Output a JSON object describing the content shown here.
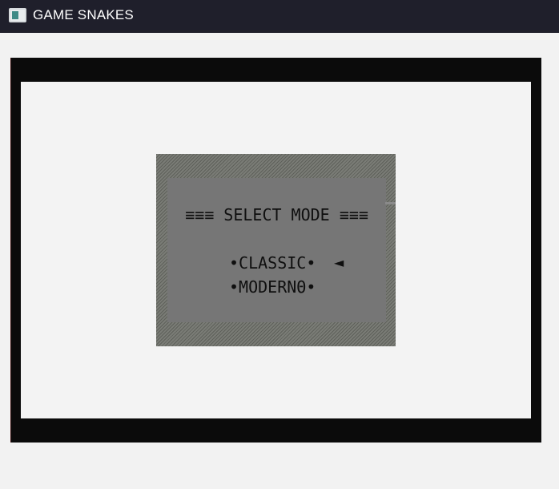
{
  "window": {
    "title": "GAME SNAKES",
    "icon": "app-window-icon"
  },
  "menu": {
    "heading": "≡≡≡ SELECT MODE ≡≡≡",
    "options": [
      {
        "label": "•CLASSIC•",
        "selected": true
      },
      {
        "label": "•MODERNΘ•",
        "selected": false
      }
    ],
    "cursor": "◄"
  },
  "colors": {
    "titlebar": "#1f1f2b",
    "frame": "#0b0b0b",
    "play_area": "#f3f3f3",
    "menu_panel": "#767676",
    "text": "#0f0f0f"
  }
}
